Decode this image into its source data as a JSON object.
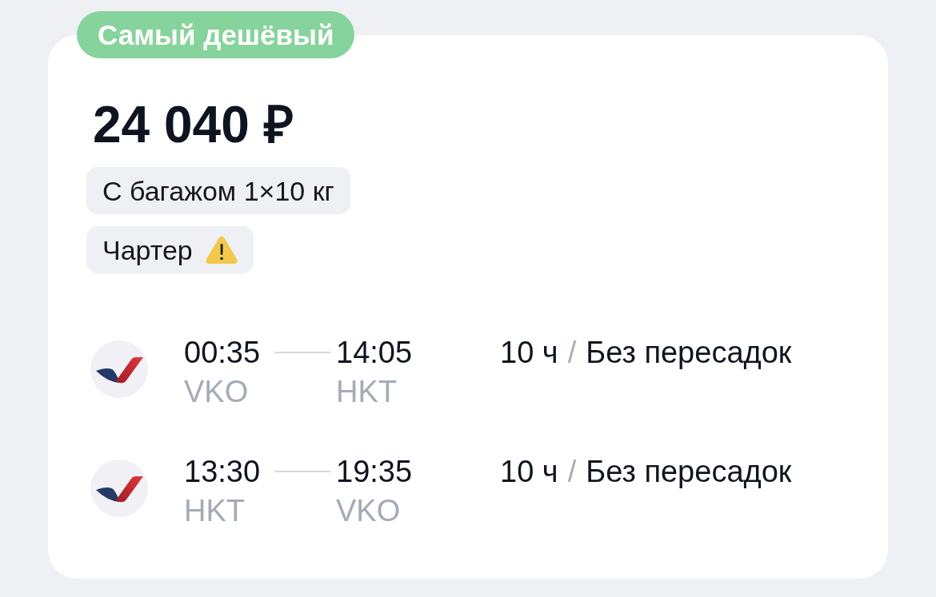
{
  "badge": "Самый дешёвый",
  "price": "24 040 ₽",
  "tags": [
    {
      "label": "С багажом 1×10 кг",
      "kind": "plain"
    },
    {
      "label": "Чартер",
      "kind": "warning"
    }
  ],
  "segments": [
    {
      "departure_time": "00:35",
      "departure_airport": "VKO",
      "arrival_time": "14:05",
      "arrival_airport": "HKT",
      "duration": "10 ч",
      "separator": "/",
      "stops": "Без пересадок"
    },
    {
      "departure_time": "13:30",
      "departure_airport": "HKT",
      "arrival_time": "19:35",
      "arrival_airport": "VKO",
      "duration": "10 ч",
      "separator": "/",
      "stops": "Без пересадок"
    }
  ]
}
